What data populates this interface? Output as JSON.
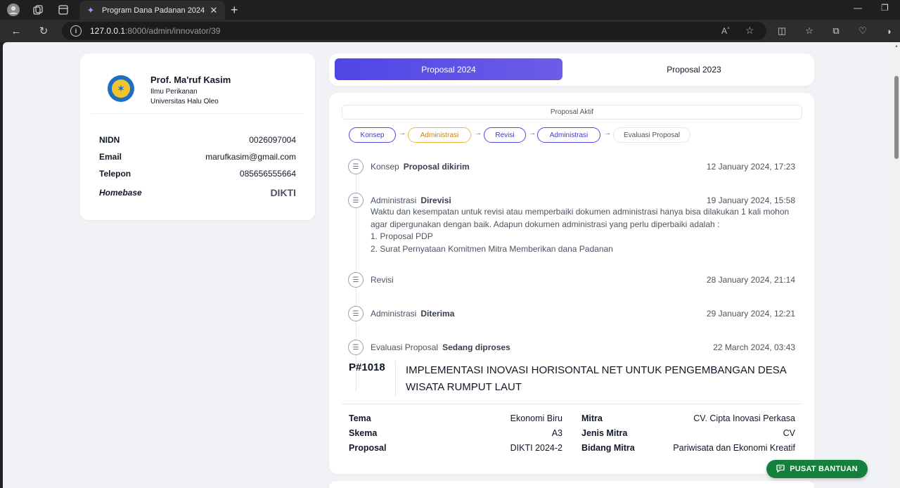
{
  "browser": {
    "tab_title": "Program Dana Padanan 2024",
    "url_host": "127.0.0.1",
    "url_path": ":8000/admin/innovator/39"
  },
  "profile": {
    "name": "Prof. Ma'ruf Kasim",
    "field": "Ilmu Perikanan",
    "university": "Universitas Halu Oleo",
    "rows": [
      {
        "label": "NIDN",
        "value": "0026097004"
      },
      {
        "label": "Email",
        "value": "marufkasim@gmail.com"
      },
      {
        "label": "Telepon",
        "value": "085656555664"
      },
      {
        "label": "Homebase",
        "value": "DIKTI"
      }
    ]
  },
  "tabs": [
    {
      "label": "Proposal 2024",
      "active": true
    },
    {
      "label": "Proposal 2023",
      "active": false
    }
  ],
  "proposal": {
    "active_label": "Proposal Aktif",
    "steps": [
      "Konsep",
      "Administrasi",
      "Revisi",
      "Administrasi",
      "Evaluasi Proposal"
    ],
    "timeline": [
      {
        "stage": "Konsep",
        "status": "Proposal dikirim",
        "time": "12 January 2024, 17:23"
      },
      {
        "stage": "Administrasi",
        "status": "Direvisi",
        "time": "19 January 2024, 15:58",
        "note": [
          "Waktu dan kesempatan untuk revisi atau memperbaiki dokumen administrasi hanya bisa dilakukan 1 kali mohon agar dipergunakan dengan baik. Adapun dokumen administrasi yang perlu diperbaiki adalah :",
          "1. Proposal PDP",
          "2. Surat Pernyataan Komitmen Mitra Memberikan dana Padanan"
        ]
      },
      {
        "stage": "Revisi",
        "status": "",
        "time": "28 January 2024, 21:14"
      },
      {
        "stage": "Administrasi",
        "status": "Diterima",
        "time": "29 January 2024, 12:21"
      },
      {
        "stage": "Evaluasi Proposal",
        "status": "Sedang diproses",
        "time": "22 March 2024, 03:43"
      }
    ],
    "code": "P#1018",
    "title": "IMPLEMENTASI INOVASI HORISONTAL NET UNTUK PENGEMBANGAN DESA WISATA RUMPUT LAUT",
    "details_left": [
      {
        "label": "Tema",
        "value": "Ekonomi Biru"
      },
      {
        "label": "Skema",
        "value": "A3"
      },
      {
        "label": "Proposal",
        "value": "DIKTI 2024-2"
      }
    ],
    "details_right": [
      {
        "label": "Mitra",
        "value": "CV. Cipta Inovasi Perkasa"
      },
      {
        "label": "Jenis Mitra",
        "value": "CV"
      },
      {
        "label": "Bidang Mitra",
        "value": "Pariwisata dan Ekonomi Kreatif"
      }
    ]
  },
  "help_button": "PUSAT BANTUAN",
  "colors": {
    "primary": "#4f46e5",
    "warning": "#f2b63b",
    "help": "#15803d"
  }
}
